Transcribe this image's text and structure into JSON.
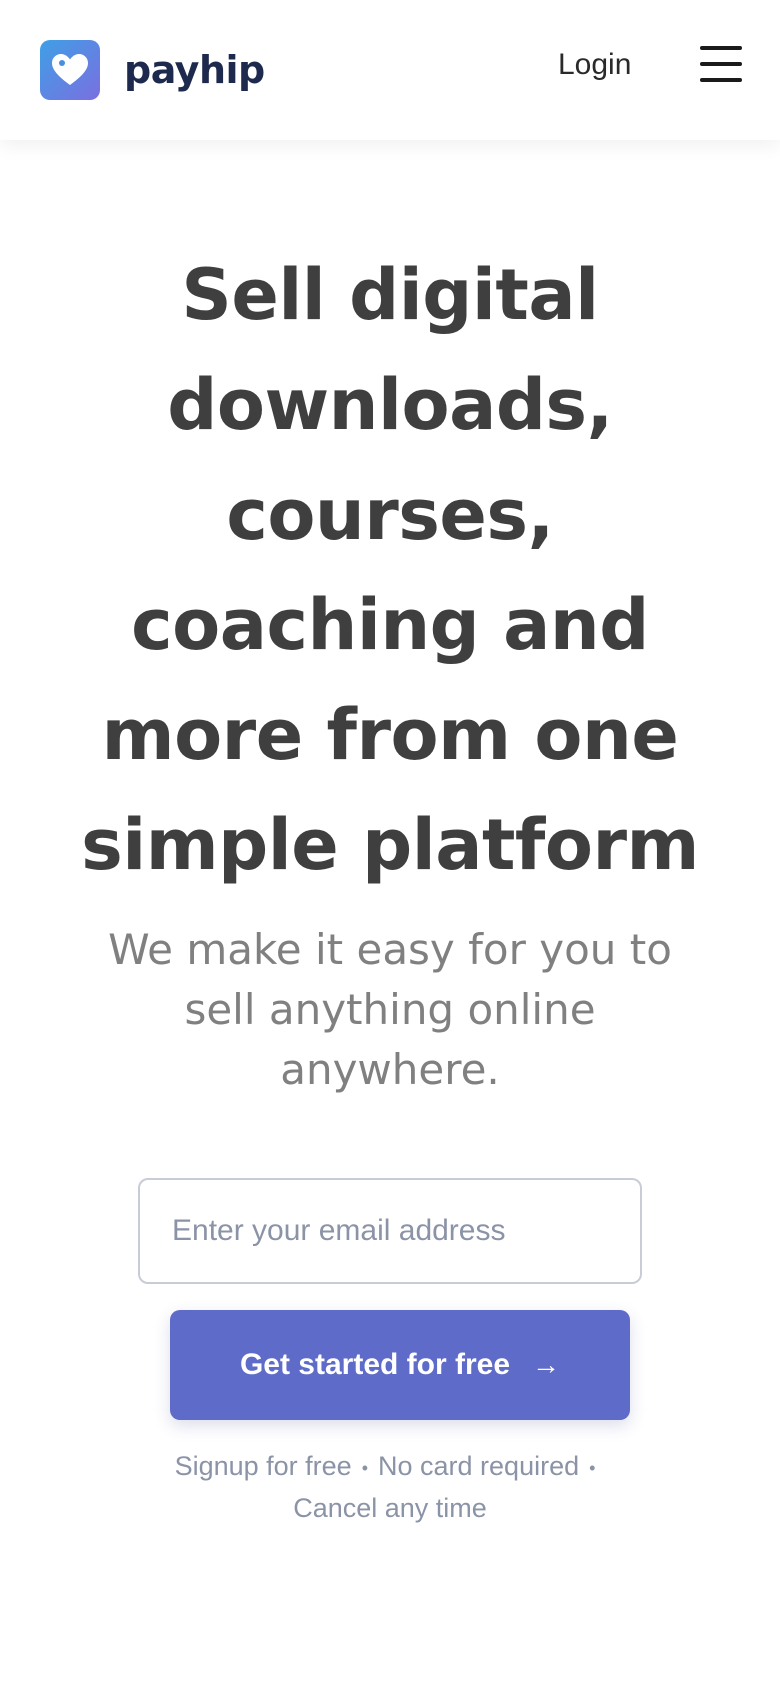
{
  "header": {
    "brand": "payhip",
    "login_label": "Login",
    "logo_icon": "heart-tag-icon",
    "menu_icon": "hamburger-menu-icon"
  },
  "hero": {
    "headline": "Sell digital downloads, courses, coaching and more from one simple platform",
    "subheadline": "We make it easy for you to sell anything online anywhere."
  },
  "signup": {
    "email_placeholder": "Enter your email address",
    "cta_label": "Get started for free",
    "cta_icon": "arrow-right-icon",
    "fineprint": {
      "item1": "Signup for free",
      "item2": "No card required",
      "item3": "Cancel any time"
    }
  },
  "colors": {
    "brand_navy": "#1e2a4d",
    "cta": "#5f6bc8",
    "logo_gradient_start": "#3f9fe6",
    "logo_gradient_end": "#7a6fe0",
    "headline": "#3f3f3f",
    "subhead": "#808080",
    "muted": "#8b93a7"
  }
}
